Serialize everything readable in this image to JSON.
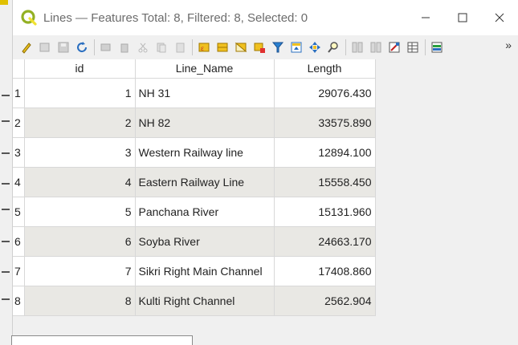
{
  "window": {
    "title": "Lines — Features Total: 8, Filtered: 8, Selected: 0",
    "controls": [
      "minimize",
      "maximize",
      "close"
    ]
  },
  "toolbar": {
    "buttons": [
      "toggle-editing-icon",
      "multi-edit-icon",
      "save-edits-icon",
      "reload-icon",
      "add-feature-icon",
      "delete-feature-icon",
      "cut-icon",
      "copy-icon",
      "paste-icon",
      "expression-select-icon",
      "select-all-icon",
      "invert-selection-icon",
      "deselect-all-icon",
      "filter-select-icon",
      "move-selection-top-icon",
      "pan-to-selection-icon",
      "zoom-to-selection-icon",
      "new-field-icon",
      "delete-field-icon",
      "field-calculator-icon",
      "conditional-formatting-icon",
      "dock-icon"
    ],
    "more": "»"
  },
  "table": {
    "headers": [
      "id",
      "Line_Name",
      "Length"
    ],
    "rows": [
      {
        "row": "1",
        "id": "1",
        "name": "NH 31",
        "length": "29076.430"
      },
      {
        "row": "2",
        "id": "2",
        "name": "NH 82",
        "length": "33575.890"
      },
      {
        "row": "3",
        "id": "3",
        "name": "Western Railway line",
        "length": "12894.100"
      },
      {
        "row": "4",
        "id": "4",
        "name": "Eastern Railway Line",
        "length": "15558.450"
      },
      {
        "row": "5",
        "id": "5",
        "name": "Panchana River",
        "length": "15131.960"
      },
      {
        "row": "6",
        "id": "6",
        "name": "Soyba River",
        "length": "24663.170"
      },
      {
        "row": "7",
        "id": "7",
        "name": "Sikri Right Main Channel",
        "length": "17408.860"
      },
      {
        "row": "8",
        "id": "8",
        "name": "Kulti Right Channel",
        "length": "2562.904"
      }
    ]
  },
  "colors": {
    "alt_row": "#e9e8e4",
    "qgis_green": "#93b023",
    "toolbar_bg": "#f0f0f0"
  }
}
